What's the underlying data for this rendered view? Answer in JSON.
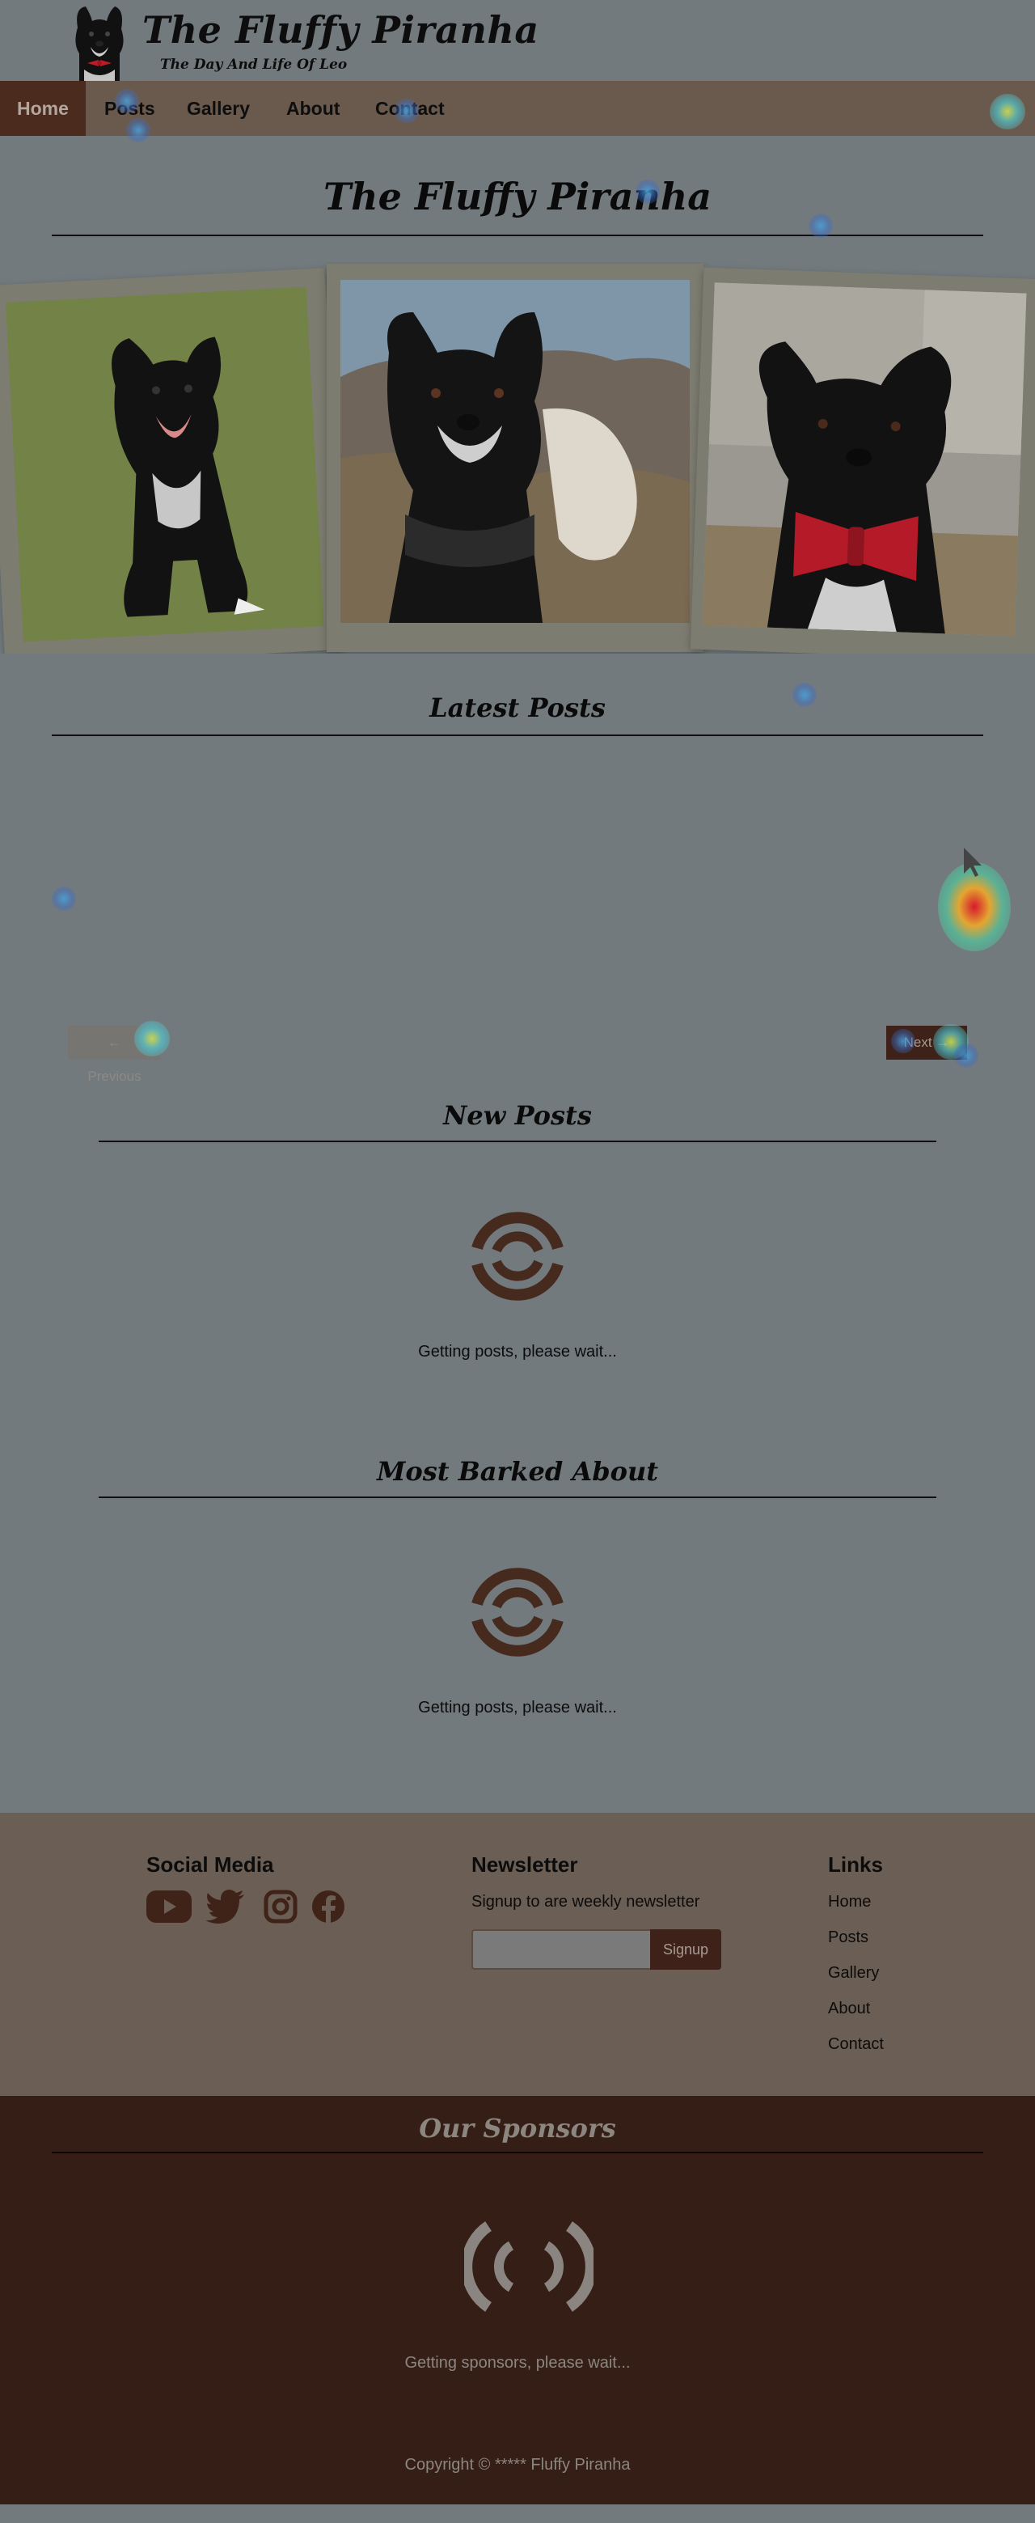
{
  "header": {
    "site_title": "The Fluffy Piranha",
    "tagline": "The Day And Life Of Leo"
  },
  "nav": {
    "items": [
      {
        "label": "Home",
        "active": true
      },
      {
        "label": "Posts",
        "active": false
      },
      {
        "label": "Gallery",
        "active": false
      },
      {
        "label": "About",
        "active": false
      },
      {
        "label": "Contact",
        "active": false
      }
    ]
  },
  "hero": {
    "title": "The Fluffy Piranha",
    "photos": [
      {
        "subject": "dog sitting on grass"
      },
      {
        "subject": "dog on rocky hillside"
      },
      {
        "subject": "dog with red bow tie"
      }
    ]
  },
  "latest_posts": {
    "title": "Latest Posts",
    "previous_label": "← Previous",
    "next_label": "Next →"
  },
  "new_posts": {
    "title": "New Posts",
    "loading_text": "Getting posts, please wait..."
  },
  "most_barked": {
    "title": "Most Barked About",
    "loading_text": "Getting posts, please wait..."
  },
  "footer": {
    "social": {
      "heading": "Social Media",
      "icons": [
        "youtube-icon",
        "twitter-icon",
        "instagram-icon",
        "facebook-icon"
      ]
    },
    "newsletter": {
      "heading": "Newsletter",
      "text": "Signup to are weekly newsletter",
      "input_placeholder": "",
      "button_label": "Signup"
    },
    "links": {
      "heading": "Links",
      "items": [
        "Home",
        "Posts",
        "Gallery",
        "About",
        "Contact"
      ]
    }
  },
  "sponsors": {
    "title": "Our Sponsors",
    "loading_text": "Getting sponsors, please wait..."
  },
  "copyright": "Copyright © ***** Fluffy Piranha",
  "colors": {
    "page_background": "#727a7d",
    "nav_background": "#6a5a4d",
    "accent_brown": "#4b2b1e",
    "sponsors_background": "#351e16",
    "footer_background": "#6b5e54"
  }
}
